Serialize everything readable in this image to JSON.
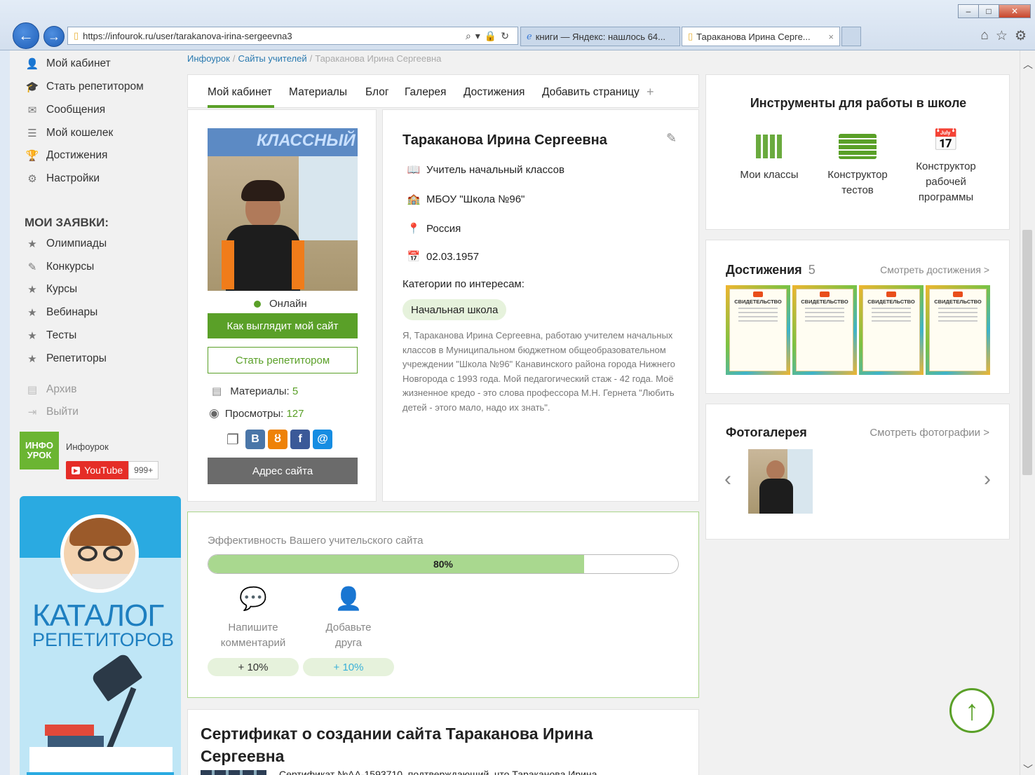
{
  "browser": {
    "url": "https://infourok.ru/user/tarakanova-irina-sergeevna3",
    "tabs": [
      {
        "title": "книги — Яндекс: нашлось 64..."
      },
      {
        "title": "Тараканова Ирина Серге..."
      }
    ],
    "tab_close": "×",
    "window_buttons": {
      "minimize": "–",
      "maximize": "□",
      "close": "✕"
    }
  },
  "sidebar": {
    "menu": [
      {
        "label": "Мой кабинет",
        "icon": "user-icon",
        "glyph": "👤"
      },
      {
        "label": "Стать репетитором",
        "icon": "graduation-cap-icon",
        "glyph": "🎓"
      },
      {
        "label": "Сообщения",
        "icon": "envelope-icon",
        "glyph": "✉"
      },
      {
        "label": "Мой кошелек",
        "icon": "coins-icon",
        "glyph": "☰"
      },
      {
        "label": "Достижения",
        "icon": "trophy-icon",
        "glyph": "🏆"
      },
      {
        "label": "Настройки",
        "icon": "gear-icon",
        "glyph": "⚙"
      }
    ],
    "requests_title": "МОИ ЗАЯВКИ:",
    "requests": [
      {
        "label": "Олимпиады",
        "icon": "star-icon",
        "glyph": "★"
      },
      {
        "label": "Конкурсы",
        "icon": "edit-icon",
        "glyph": "✎"
      },
      {
        "label": "Курсы",
        "icon": "star-icon",
        "glyph": "★"
      },
      {
        "label": "Вебинары",
        "icon": "star-icon",
        "glyph": "★"
      },
      {
        "label": "Тесты",
        "icon": "star-icon",
        "glyph": "★"
      },
      {
        "label": "Репетиторы",
        "icon": "star-icon",
        "glyph": "★"
      }
    ],
    "extra": [
      {
        "label": "Архив",
        "icon": "archive-icon",
        "glyph": "▤"
      },
      {
        "label": "Выйти",
        "icon": "logout-icon",
        "glyph": "⇥"
      }
    ],
    "channel": {
      "logo_line1": "ИНФО",
      "logo_line2": "УРОК",
      "name": "Инфоурок",
      "youtube": "YouTube",
      "subscribers": "999+"
    },
    "banner": {
      "line1": "КАТАЛОГ",
      "line2": "РЕПЕТИТОРОВ"
    }
  },
  "breadcrumb": [
    {
      "label": "Инфоурок"
    },
    {
      "label": "Сайты учителей"
    },
    {
      "label": "Тараканова Ирина Сергеевна"
    }
  ],
  "breadcrumb_sep": "/",
  "nav_tabs": [
    "Мой кабинет",
    "Материалы",
    "Блог",
    "Галерея",
    "Достижения",
    "Добавить страницу"
  ],
  "nav_add_glyph": "+",
  "profile": {
    "status": "Онлайн",
    "view_site_button": "Как выглядит мой сайт",
    "become_tutor_button": "Стать репетитором",
    "materials_label": "Материалы:",
    "materials_count": "5",
    "views_label": "Просмотры:",
    "views_count": "127",
    "site_address_button": "Адрес сайта",
    "photo_banner_text": "КЛАССНЫЙ"
  },
  "details": {
    "name": "Тараканова Ирина Сергеевна",
    "position": "Учитель начальный классов",
    "school": "МБОУ \"Школа №96\"",
    "country": "Россия",
    "birthdate": "02.03.1957",
    "categories_label": "Категории по интересам:",
    "category_tag": "Начальная школа",
    "bio": "Я, Тараканова Ирина Сергеевна, работаю учителем начальных классов в Муниципальном бюджетном общеобразовательном учреждении \"Школа №96\" Канавинского района города Нижнего Новгорода с 1993 года. Мой педагогический стаж - 42 года. Моё жизненное кредо - это слова профессора М.Н. Гернета \"Любить детей - этого мало, надо их знать\"."
  },
  "efficiency": {
    "title": "Эффективность Вашего учительского сайта",
    "percent_label": "80%",
    "progress": 0.8,
    "actions": [
      {
        "label_line1": "Напишите",
        "label_line2": "комментарий",
        "bonus": "+ 10%"
      },
      {
        "label_line1": "Добавьте",
        "label_line2": "друга",
        "bonus": "+ 10%"
      }
    ]
  },
  "certificate": {
    "title_line1": "Сертификат о создании сайта Тараканова Ирина",
    "title_line2": "Сергеевна",
    "text": "Сертификат №АА-1593710, подтверждающий, что Тараканова Ирина"
  },
  "tools": {
    "title": "Инструменты для работы в школе",
    "items": [
      {
        "line1": "Мои классы",
        "line2": "",
        "line3": ""
      },
      {
        "line1": "Конструктор",
        "line2": "тестов",
        "line3": ""
      },
      {
        "line1": "Конструктор",
        "line2": "рабочей",
        "line3": "программы"
      }
    ]
  },
  "achievements": {
    "title": "Достижения",
    "count": "5",
    "link": "Смотреть достижения >",
    "cert_label": "СВИДЕТЕЛЬСТВО"
  },
  "gallery": {
    "title": "Фотогалерея",
    "link": "Смотреть фотографии >",
    "prev": "‹",
    "next": "›"
  },
  "colors": {
    "accent": "#5aa028",
    "link": "#2a7ab0",
    "dark_button": "#6b6b6b"
  }
}
